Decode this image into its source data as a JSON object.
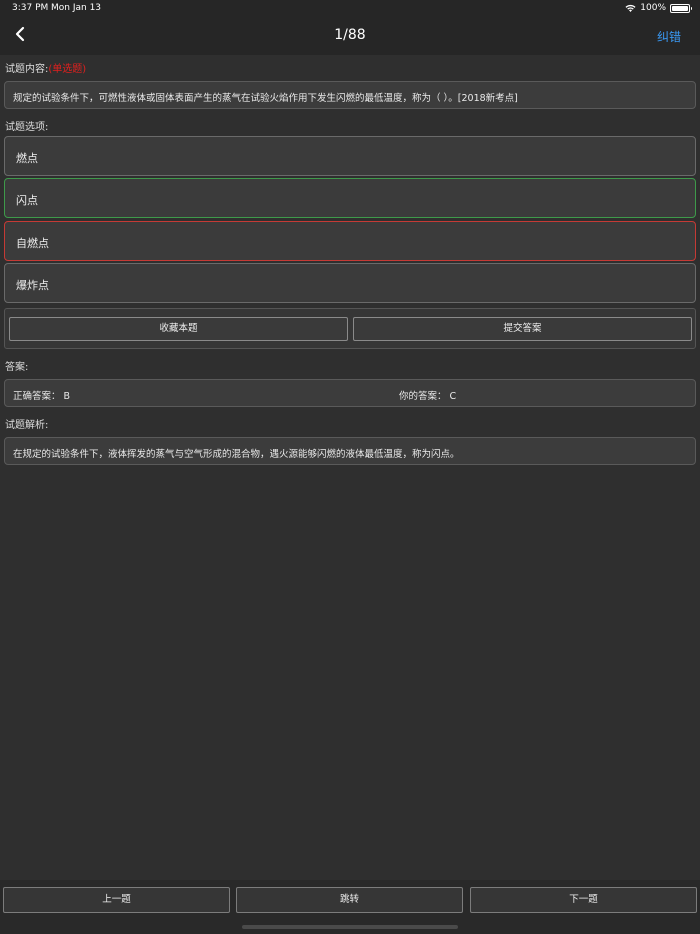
{
  "status_bar": {
    "time": "3:37 PM",
    "date": "Mon Jan 13",
    "battery": "100%",
    "icons": [
      "wifi-icon",
      "battery-icon"
    ]
  },
  "nav": {
    "back_icon": "chevron-left-icon",
    "title": "1/88",
    "right_action": "纠错",
    "accent_color": "#3a9af5"
  },
  "question": {
    "label": "试题内容:",
    "type": "(单选题)",
    "text": "规定的试验条件下，可燃性液体或固体表面产生的蒸气在试验火焰作用下发生闪燃的最低温度，称为（   ）。[2018新考点]"
  },
  "options_label": "试题选项:",
  "options": [
    {
      "label": "燃点",
      "state": "normal"
    },
    {
      "label": "闪点",
      "state": "correct"
    },
    {
      "label": "自燃点",
      "state": "wrong"
    },
    {
      "label": "爆炸点",
      "state": "normal"
    }
  ],
  "actions": {
    "favorite": "收藏本题",
    "submit": "提交答案"
  },
  "answer": {
    "label": "答案:",
    "correct_text": "正确答案：  B",
    "yours_text": "你的答案：  C"
  },
  "analysis": {
    "label": "试题解析:",
    "text": "在规定的试验条件下，液体挥发的蒸气与空气形成的混合物，遇火源能够闪燃的液体最低温度，称为闪点。"
  },
  "bottom_nav": {
    "prev": "上一题",
    "jump": "跳转",
    "next": "下一题"
  },
  "colors": {
    "background": "#2f2f2f",
    "correct_border": "#3e9a4a",
    "wrong_border": "#c53a35",
    "type_tag": "#e0201e"
  }
}
